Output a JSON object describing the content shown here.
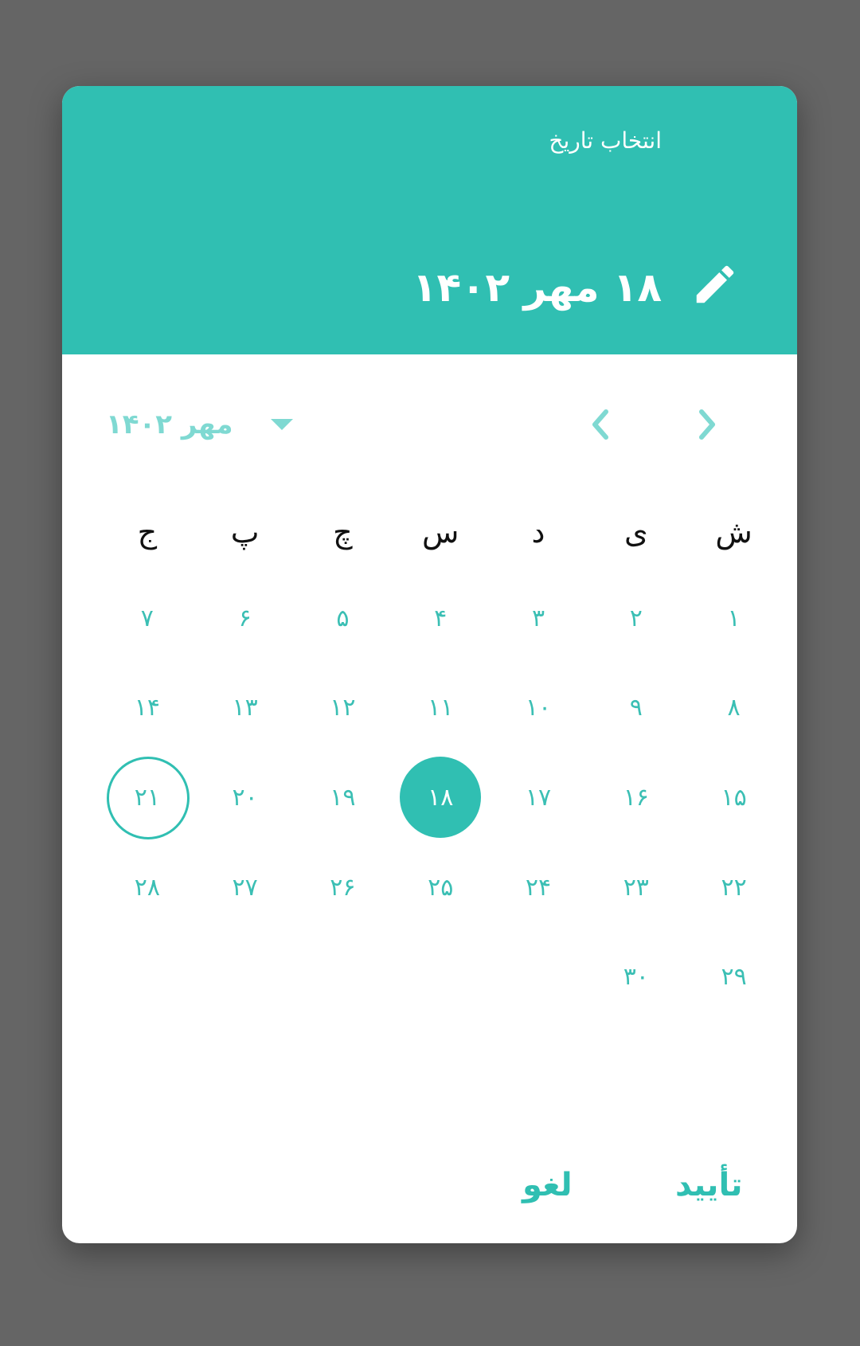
{
  "header": {
    "label": "انتخاب تاریخ",
    "selected_date": "۱۸ مهر ۱۴۰۲"
  },
  "nav": {
    "month_year": "مهر ۱۴۰۲"
  },
  "weekdays": [
    "ش",
    "ی",
    "د",
    "س",
    "چ",
    "پ",
    "ج"
  ],
  "days": [
    "۱",
    "۲",
    "۳",
    "۴",
    "۵",
    "۶",
    "۷",
    "۸",
    "۹",
    "۱۰",
    "۱۱",
    "۱۲",
    "۱۳",
    "۱۴",
    "۱۵",
    "۱۶",
    "۱۷",
    "۱۸",
    "۱۹",
    "۲۰",
    "۲۱",
    "۲۲",
    "۲۳",
    "۲۴",
    "۲۵",
    "۲۶",
    "۲۷",
    "۲۸",
    "۲۹",
    "۳۰"
  ],
  "selected_day": "۱۸",
  "today_day": "۲۱",
  "actions": {
    "ok": "تأیید",
    "cancel": "لغو"
  },
  "colors": {
    "accent": "#30bfb2",
    "accent_light": "#7fd9d2",
    "overlay": "#656565"
  },
  "icons": {
    "edit": "pencil-icon",
    "dropdown": "triangle-down-icon",
    "prev": "chevron-left-icon",
    "next": "chevron-right-icon"
  }
}
